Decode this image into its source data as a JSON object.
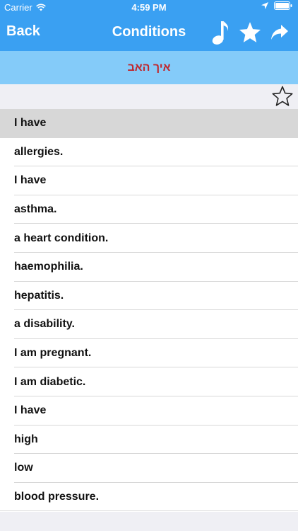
{
  "status_bar": {
    "carrier": "Carrier",
    "time": "4:59 PM"
  },
  "nav": {
    "back_label": "Back",
    "title": "Conditions"
  },
  "banner": {
    "text": "איך האב"
  },
  "list": {
    "items": [
      "I have",
      "allergies.",
      "I have",
      "asthma.",
      "a heart condition.",
      "haemophilia.",
      "hepatitis.",
      "a disability.",
      "I am pregnant.",
      "I am diabetic.",
      "I have",
      "high",
      "low",
      "blood pressure."
    ]
  },
  "colors": {
    "nav_bg": "#3aa0f2",
    "banner_bg": "#84cbf9",
    "banner_text": "#c0272d",
    "selected_row": "#d7d7d7"
  },
  "icons": {
    "nav": [
      "music-note-icon",
      "star-filled-icon",
      "share-arrow-icon"
    ],
    "favorite": "star-outline-icon"
  }
}
